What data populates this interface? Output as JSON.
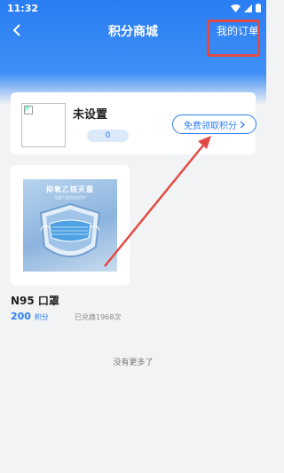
{
  "status_bar": {
    "time": "11:32"
  },
  "header": {
    "title": "积分商城",
    "back_icon": "back-chevron-icon",
    "orders_label": "我的订单"
  },
  "user": {
    "name": "未设置",
    "points": "0",
    "earn_button_label": "免费领取积分"
  },
  "products": [
    {
      "name": "N95 口罩",
      "points": "200",
      "unit": "积分",
      "redeemed": "已兑换1968次",
      "image_title": "抑氧乙烷灭菌",
      "image_sub": "无菌产品的安全保护"
    }
  ],
  "footer": {
    "no_more": "没有更多了"
  },
  "colors": {
    "brand": "#2e7ef1",
    "header_top": "#2a7ef3",
    "annotation": "#e14b45",
    "background": "#f2f3f5"
  }
}
